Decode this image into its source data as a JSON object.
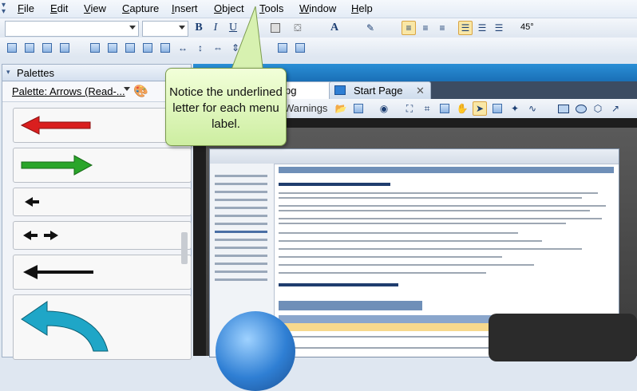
{
  "menu": {
    "items": [
      {
        "label": "File",
        "accel": "F",
        "rest": "ile"
      },
      {
        "label": "Edit",
        "accel": "E",
        "rest": "dit"
      },
      {
        "label": "View",
        "accel": "V",
        "rest": "iew"
      },
      {
        "label": "Capture",
        "accel": "C",
        "rest": "apture"
      },
      {
        "label": "Insert",
        "accel": "I",
        "rest": "nsert"
      },
      {
        "label": "Object",
        "accel": "O",
        "rest": "bject"
      },
      {
        "label": "Tools",
        "accel": "T",
        "rest": "ools"
      },
      {
        "label": "Window",
        "accel": "W",
        "rest": "indow"
      },
      {
        "label": "Help",
        "accel": "H",
        "rest": "elp"
      }
    ]
  },
  "format_toolbar": {
    "bold": "B",
    "italic": "I",
    "underline": "U",
    "rotation": "45°"
  },
  "palettes": {
    "title": "Palettes",
    "select_label": "Palette: Arrows (Read-..."
  },
  "document": {
    "tab_partial": "pg",
    "tab_start": "Start Page",
    "warnings_label": "Warnings"
  },
  "callout": {
    "text": "Notice the underlined letter for each menu label."
  },
  "colors": {
    "accent_blue": "#1a6fb6",
    "callout_fill": "#d8f1b2",
    "arrow_red": "#d91f1f",
    "arrow_green": "#2aa52a",
    "arrow_teal": "#1fa6c7"
  },
  "icons": [
    "grip-icon",
    "paint-bucket-icon",
    "font-color-icon",
    "line-color-icon",
    "align-left-icon",
    "align-center-icon",
    "align-right-icon",
    "palette-icon",
    "pin-icon",
    "hand-icon",
    "pointer-icon",
    "magic-wand-icon",
    "rectangle-icon",
    "oval-icon",
    "polygon-icon"
  ]
}
